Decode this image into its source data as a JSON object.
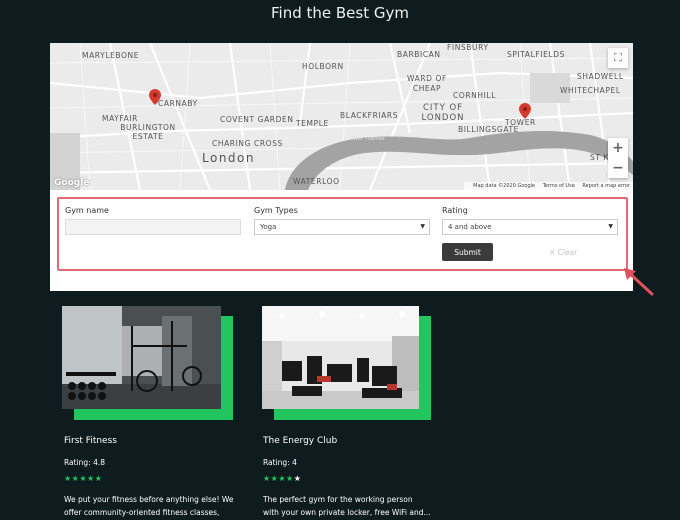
{
  "page": {
    "title": "Find the Best Gym"
  },
  "map": {
    "labels": {
      "marylebone": "MARYLEBONE",
      "holborn": "HOLBORN",
      "barbican": "BARBICAN",
      "finsbury": "FINSBURY",
      "spitalfields": "SPITALFIELDS",
      "shadwell": "SHADWELL",
      "whitechapel": "WHITECHAPEL",
      "ward_of_cheap": "WARD OF CHEAP",
      "cornhill": "CORNHILL",
      "mayfair": "MAYFAIR",
      "burlington_estate": "BURLINGTON ESTATE",
      "carnaby": "CARNABY",
      "covent_garden": "COVENT GARDEN",
      "temple": "TEMPLE",
      "blackfriars": "BLACKFRIARS",
      "city_of_london": "CITY OF LONDON",
      "billingsgate": "BILLINGSGATE",
      "tower": "TOWER",
      "charing_cross": "CHARING CROSS",
      "london": "London",
      "waterloo": "WATERLOO",
      "st_k": "ST K"
    },
    "google": "Google",
    "footer": {
      "data": "Map data ©2020 Google",
      "terms": "Terms of Use",
      "report": "Report a map error"
    },
    "zoom_in": "+",
    "zoom_out": "−",
    "fullscreen": "⛶",
    "pin_color": "#d63a2e"
  },
  "form": {
    "gym_name": {
      "label": "Gym name",
      "value": "",
      "placeholder": ""
    },
    "gym_types": {
      "label": "Gym Types",
      "selected": "Yoga"
    },
    "rating": {
      "label": "Rating",
      "selected": "4 and above"
    },
    "submit_label": "Submit",
    "clear_label": "× Clear",
    "highlight_color": "#e06b74"
  },
  "gyms": [
    {
      "name": "First Fitness",
      "rating_text": "Rating: 4.8",
      "rating": 4.8,
      "stars_filled": 5,
      "description_line1": "We put your fitness before anything else! We",
      "description_line2": "offer community-oriented fitness classes,"
    },
    {
      "name": "The Energy Club",
      "rating_text": "Rating: 4",
      "rating": 4,
      "stars_filled": 4,
      "description_line1": "The perfect gym for the working person",
      "description_line2": "with your own private locker, free WiFi and..."
    }
  ],
  "colors": {
    "background": "#0f1c1f",
    "accent_green": "#22c55e",
    "arrow": "#e0505d"
  }
}
